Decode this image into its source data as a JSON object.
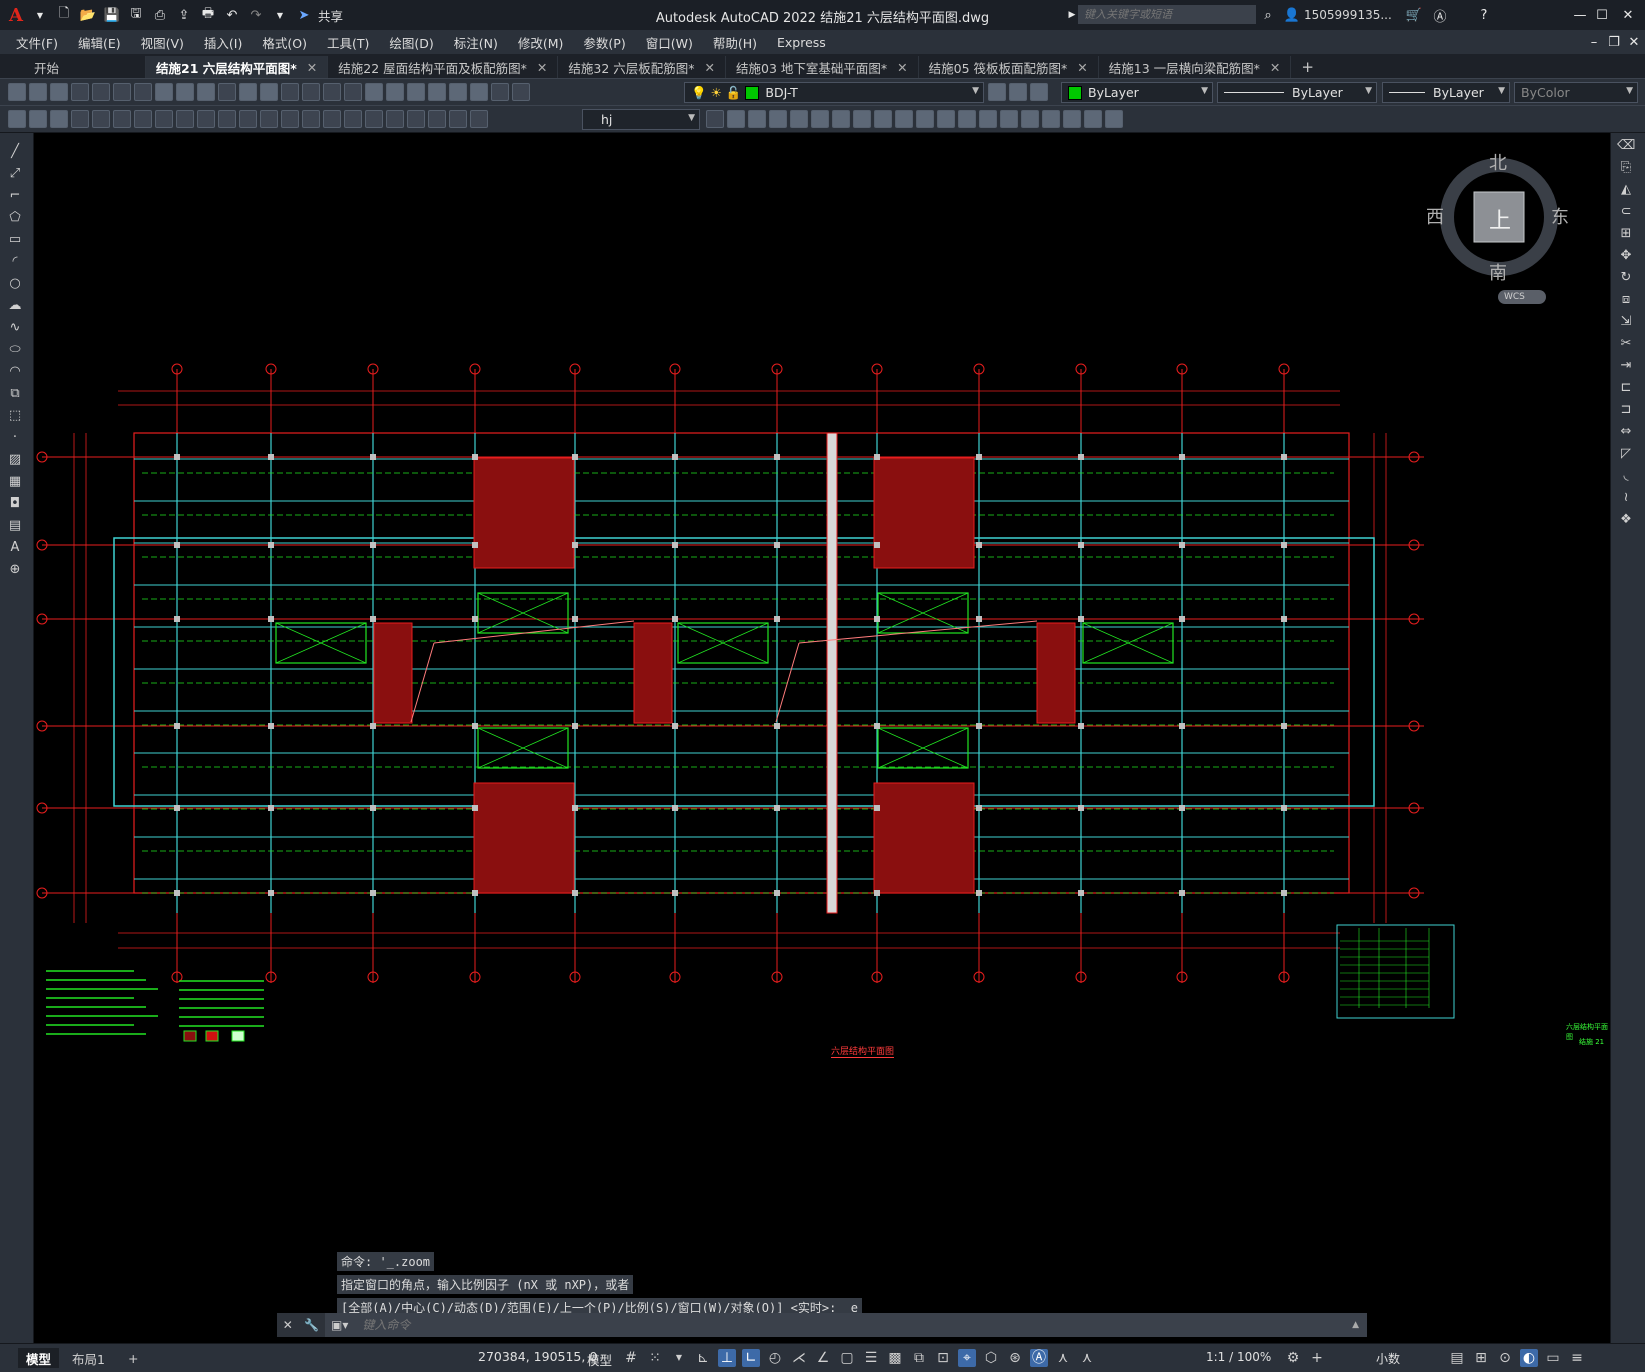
{
  "window": {
    "title": "Autodesk AutoCAD 2022    结施21 六层结构平面图.dwg",
    "search_placeholder": "键入关键字或短语",
    "user": "1505999135...",
    "share_label": "共享"
  },
  "menu": [
    "文件(F)",
    "编辑(E)",
    "视图(V)",
    "插入(I)",
    "格式(O)",
    "工具(T)",
    "绘图(D)",
    "标注(N)",
    "修改(M)",
    "参数(P)",
    "窗口(W)",
    "帮助(H)",
    "Express"
  ],
  "tabs": [
    {
      "label": "开始",
      "close": ""
    },
    {
      "label": "结施21 六层结构平面图*",
      "close": "✕"
    },
    {
      "label": "结施22 屋面结构平面及板配筋图*",
      "close": "✕"
    },
    {
      "label": "结施32 六层板配筋图*",
      "close": "✕"
    },
    {
      "label": "结施03 地下室基础平面图*",
      "close": "✕"
    },
    {
      "label": "结施05 筏板板面配筋图*",
      "close": "✕"
    },
    {
      "label": "结施13 一层横向梁配筋图*",
      "close": "✕"
    }
  ],
  "new_tab": "+",
  "properties": {
    "layer": "BDJ-T",
    "color": "ByLayer",
    "linetype": "ByLayer",
    "lineweight": "ByLayer",
    "plotstyle": "ByColor",
    "dimstyle": "hj",
    "layer_color": "#00c800",
    "color_swatch": "#00c800"
  },
  "viewcube": {
    "north": "北",
    "south": "南",
    "east": "东",
    "west": "西",
    "face": "上",
    "wcs": "WCS"
  },
  "drawing": {
    "caption": "六层结构平面图",
    "side_title_1": "六层结构平面图",
    "side_title_2": "结施 21"
  },
  "command_history": [
    "命令: '_.zoom",
    "指定窗口的角点，输入比例因子 (nX 或 nXP)，或者",
    "[全部(A)/中心(C)/动态(D)/范围(E)/上一个(P)/比例(S)/窗口(W)/对象(O)] <实时>: _e"
  ],
  "command_placeholder": "键入命令",
  "status": {
    "model_tab": "模型",
    "layout_tab": "布局1",
    "add_tab": "+",
    "coords": "270384, 190515, 0",
    "space": "模型",
    "scale": "1:1 / 100%",
    "units": "小数"
  }
}
